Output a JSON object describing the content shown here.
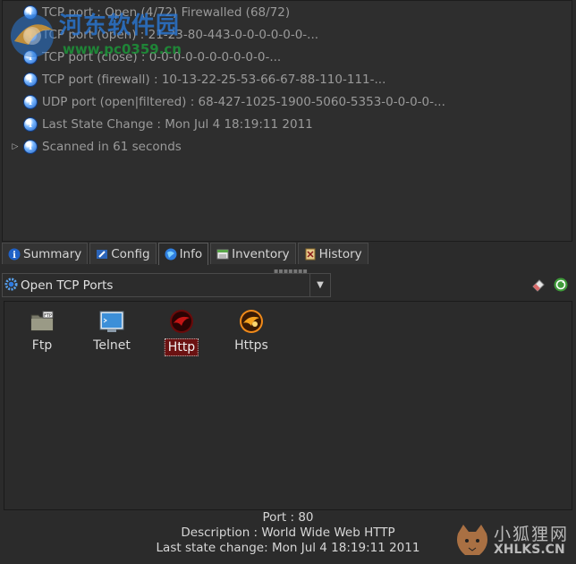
{
  "tree": {
    "rows": [
      {
        "text": "TCP port : Open (4/72) Firewalled (68/72)",
        "expander": ""
      },
      {
        "text": "TCP port (open) : 21-23-80-443-0-0-0-0-0-0-...",
        "expander": ""
      },
      {
        "text": "TCP port (close) : 0-0-0-0-0-0-0-0-0-0-...",
        "expander": ""
      },
      {
        "text": "TCP port (firewall) : 10-13-22-25-53-66-67-88-110-111-...",
        "expander": ""
      },
      {
        "text": "UDP port (open|filtered) : 68-427-1025-1900-5060-5353-0-0-0-0-...",
        "expander": ""
      },
      {
        "text": "Last State Change : Mon Jul  4 18:19:11 2011",
        "expander": ""
      },
      {
        "text": "Scanned in 61 seconds",
        "expander": "▷"
      }
    ]
  },
  "watermark": {
    "cn": "河东软件园",
    "url": "www.pc0359.cn"
  },
  "tabs": [
    {
      "label": "Summary",
      "icon": "info-icon"
    },
    {
      "label": "Config",
      "icon": "config-icon"
    },
    {
      "label": "Info",
      "icon": "info-globe-icon",
      "active": true
    },
    {
      "label": "Inventory",
      "icon": "inventory-icon"
    },
    {
      "label": "History",
      "icon": "history-icon"
    }
  ],
  "combo": {
    "selected": "Open TCP Ports"
  },
  "services": [
    {
      "label": "Ftp",
      "icon": "ftp-folder-icon"
    },
    {
      "label": "Telnet",
      "icon": "telnet-monitor-icon"
    },
    {
      "label": "Http",
      "icon": "http-icon",
      "selected": true
    },
    {
      "label": "Https",
      "icon": "https-icon"
    }
  ],
  "details": {
    "port": "Port : 80",
    "description": "Description :  World Wide Web HTTP",
    "last_change": "Last state change:  Mon Jul  4 18:19:11 2011"
  },
  "corner_watermark": {
    "cn": "小狐狸网",
    "en": "XHLKS.CN"
  },
  "colors": {
    "background": "#2b2b2b",
    "text": "#c8c8c8",
    "selection": "#6b1212",
    "accent_blue": "#2a78d6"
  }
}
